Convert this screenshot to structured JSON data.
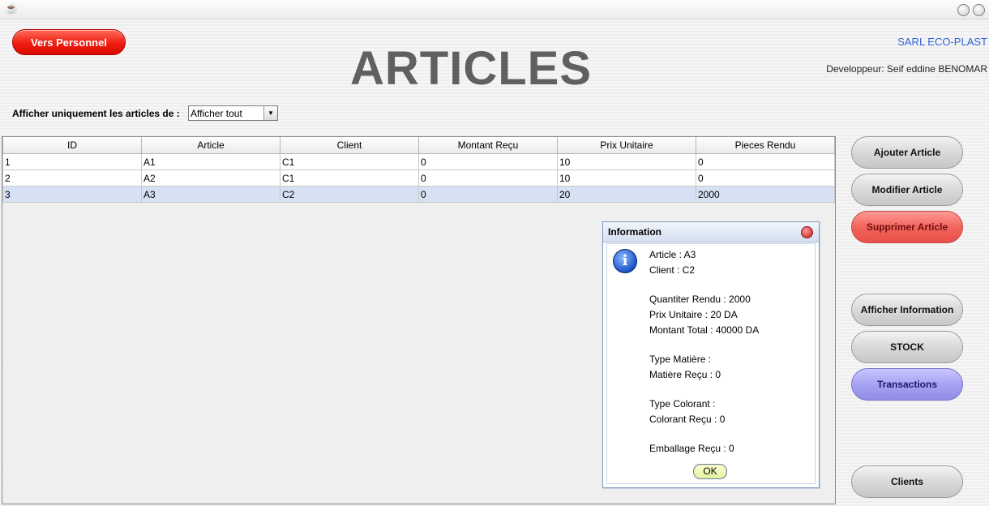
{
  "window": {
    "title": "",
    "icon": "coffee-cup-icon"
  },
  "header": {
    "back_button": "Vers Personnel",
    "title": "ARTICLES",
    "company": "SARL ECO-PLAST",
    "developer": "Developpeur: Seif eddine BENOMAR"
  },
  "filter": {
    "label": "Afficher uniquement les articles de :",
    "selected": "Afficher tout"
  },
  "table": {
    "columns": [
      "ID",
      "Article",
      "Client",
      "Montant Reçu",
      "Prix Unitaire",
      "Pieces Rendu"
    ],
    "rows": [
      [
        "1",
        "A1",
        "C1",
        "0",
        "10",
        "0"
      ],
      [
        "2",
        "A2",
        "C1",
        "0",
        "10",
        "0"
      ],
      [
        "3",
        "A3",
        "C2",
        "0",
        "20",
        "2000"
      ]
    ],
    "selected_row": 2
  },
  "sidebar": {
    "add": "Ajouter Article",
    "edit": "Modifier Article",
    "delete": "Supprimer Article",
    "info": "Afficher Information",
    "stock": "STOCK",
    "transactions": "Transactions",
    "clients": "Clients"
  },
  "dialog": {
    "title": "Information",
    "lines": [
      "Article :  A3",
      "Client :  C2",
      "Quantiter Rendu :  2000",
      "Prix Unitaire :  20 DA",
      "Montant Total :  40000 DA",
      "Type Matière :",
      "Matière Reçu :  0",
      "Type Colorant :",
      "Colorant Reçu :  0",
      "Emballage Reçu :  0"
    ],
    "ok": "OK"
  },
  "colors": {
    "delete_button": "#f2645c",
    "transactions_button": "#a7a3f2",
    "back_button": "#f01d10",
    "company_text": "#2e63d8",
    "selected_row": "#d6e1f3"
  }
}
